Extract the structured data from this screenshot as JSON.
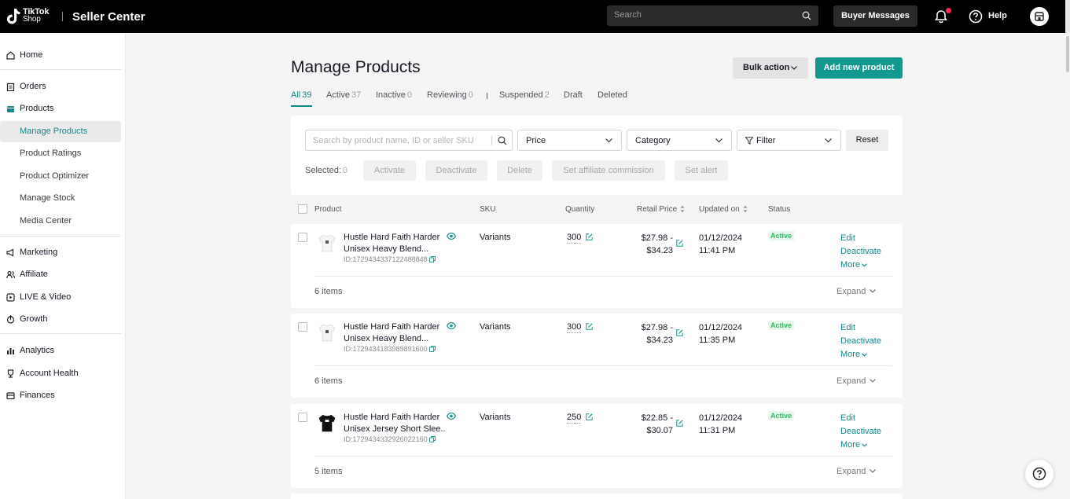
{
  "header": {
    "logo_line1": "TikTok",
    "logo_line2": "Shop",
    "app_title": "Seller Center",
    "search_placeholder": "Search",
    "buyer_messages": "Buyer Messages",
    "help": "Help"
  },
  "sidebar": {
    "home": "Home",
    "orders": "Orders",
    "products": "Products",
    "products_sub": [
      "Manage Products",
      "Product Ratings",
      "Product Optimizer",
      "Manage Stock",
      "Media Center"
    ],
    "marketing": "Marketing",
    "affiliate": "Affiliate",
    "live_video": "LIVE & Video",
    "growth": "Growth",
    "analytics": "Analytics",
    "account_health": "Account Health",
    "finances": "Finances"
  },
  "main": {
    "title": "Manage Products",
    "bulk_action": "Bulk action",
    "add_new": "Add new product",
    "tabs": [
      {
        "label": "All",
        "count": "39"
      },
      {
        "label": "Active",
        "count": "37"
      },
      {
        "label": "Inactive",
        "count": "0"
      },
      {
        "label": "Reviewing",
        "count": "0"
      },
      {
        "label": "Suspended",
        "count": "2"
      },
      {
        "label": "Draft",
        "count": ""
      },
      {
        "label": "Deleted",
        "count": ""
      }
    ]
  },
  "filters": {
    "search_placeholder": "Search by product name, ID or seller SKU",
    "price": "Price",
    "category": "Category",
    "filter": "Filter",
    "reset": "Reset",
    "selected_label": "Selected:",
    "selected_count": "0",
    "activate": "Activate",
    "deactivate": "Deactivate",
    "delete": "Delete",
    "set_affiliate": "Set affiliate commission",
    "set_alert": "Set alert"
  },
  "table": {
    "columns": [
      "Product",
      "SKU",
      "Quantity",
      "Retail Price",
      "Updated on",
      "Status"
    ],
    "rows": [
      {
        "name1": "Hustle Hard Faith Harder",
        "name2": "Unisex Heavy Blend...",
        "id": "ID:1729434337122488848",
        "sku": "Variants",
        "quantity": "300",
        "price1": "$27.98 -",
        "price2": "$34.23",
        "date": "01/12/2024",
        "time": "11:41 PM",
        "status": "Active",
        "edit": "Edit",
        "deactivate": "Deactivate",
        "more": "More",
        "items": "6 items",
        "expand": "Expand",
        "shirt_color": "#f4f4f4"
      },
      {
        "name1": "Hustle Hard Faith Harder",
        "name2": "Unisex Heavy Blend...",
        "id": "ID:1729434183989891600",
        "sku": "Variants",
        "quantity": "300",
        "price1": "$27.98 -",
        "price2": "$34.23",
        "date": "01/12/2024",
        "time": "11:35 PM",
        "status": "Active",
        "edit": "Edit",
        "deactivate": "Deactivate",
        "more": "More",
        "items": "6 items",
        "expand": "Expand",
        "shirt_color": "#f4f4f4"
      },
      {
        "name1": "Hustle Hard Faith Harder",
        "name2": "Unisex Jersey Short Slee...",
        "id": "ID:1729434332926022160",
        "sku": "Variants",
        "quantity": "250",
        "price1": "$22.85 -",
        "price2": "$30.07",
        "date": "01/12/2024",
        "time": "11:31 PM",
        "status": "Active",
        "edit": "Edit",
        "deactivate": "Deactivate",
        "more": "More",
        "items": "5 items",
        "expand": "Expand",
        "shirt_color": "#111111"
      }
    ]
  },
  "colors": {
    "accent": "#13988f",
    "status_active": "#2bbd5b",
    "notification_dot": "#fe2c55"
  }
}
